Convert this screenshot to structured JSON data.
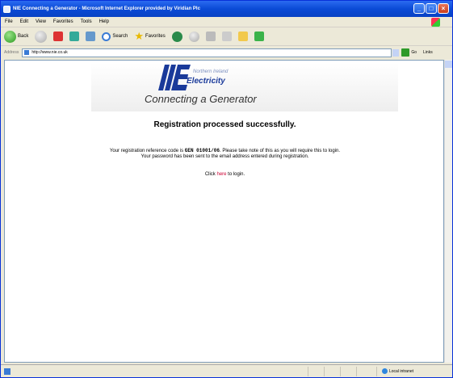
{
  "window": {
    "title": "NIE Connecting a Generator - Microsoft Internet Explorer provided by Viridian Plc"
  },
  "menu": [
    "File",
    "Edit",
    "View",
    "Favorites",
    "Tools",
    "Help"
  ],
  "toolbar": {
    "back": "Back",
    "search": "Search",
    "favorites": "Favorites"
  },
  "address": {
    "label": "Address",
    "url": "http://www.nie.co.uk",
    "go": "Go",
    "links": "Links"
  },
  "page": {
    "logo_line1": "Northern Ireland",
    "logo_line2": "Electricity",
    "banner_title": "Connecting a Generator",
    "headline": "Registration processed successfully.",
    "ref_prefix": "Your registration reference code is ",
    "ref_code": "GEN 01001/06",
    "ref_suffix": ". Please take note of this as you will require this to login.",
    "password_msg": "Your password has been sent to the email address entered during registration.",
    "click_prefix": "Click ",
    "click_link": "here",
    "click_suffix": " to login."
  },
  "status": {
    "zone": "Local intranet"
  },
  "colors": {
    "titlebar": "#0a4ad6",
    "link": "#cc0033",
    "logo_blue": "#1a3a9a"
  }
}
